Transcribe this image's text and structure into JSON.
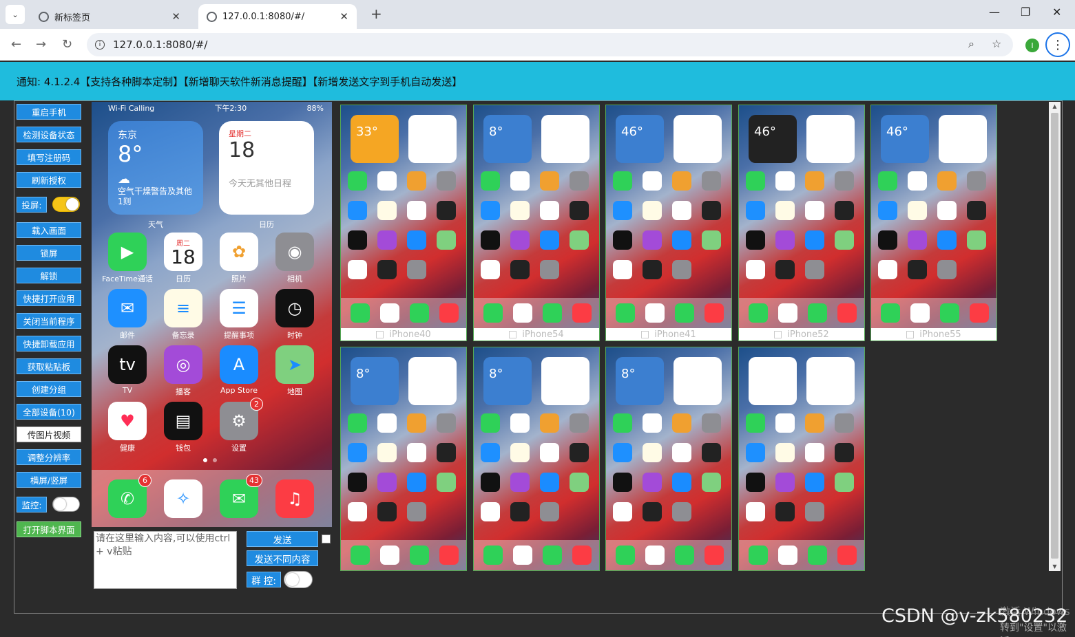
{
  "browser": {
    "tabs": [
      {
        "label": "新标签页"
      },
      {
        "label": "127.0.0.1:8080/#/"
      }
    ],
    "url": "127.0.0.1:8080/#/",
    "profile_initial": "I"
  },
  "notice": {
    "text": "通知:   4.1.2.4【支持各种脚本定制】【新增聊天软件新消息提醒】【新增发送文字到手机自动发送】"
  },
  "sidebar": {
    "items": [
      {
        "label": "重启手机"
      },
      {
        "label": "检测设备状态"
      },
      {
        "label": "填写注册码"
      },
      {
        "label": "刷新授权"
      },
      {
        "label": "投屏:"
      },
      {
        "label": "载入画面"
      },
      {
        "label": "锁屏"
      },
      {
        "label": "解锁"
      },
      {
        "label": "快捷打开应用"
      },
      {
        "label": "关闭当前程序"
      },
      {
        "label": "快捷卸载应用"
      },
      {
        "label": "获取粘贴板"
      },
      {
        "label": "创建分组"
      },
      {
        "label": "全部设备(10)"
      },
      {
        "label": "传图片视频"
      },
      {
        "label": "调整分辨率"
      },
      {
        "label": "横屏/竖屏"
      },
      {
        "label": "监控:"
      },
      {
        "label": "打开脚本界面"
      }
    ],
    "screen_cast_on": true,
    "monitor_on": false
  },
  "main_phone": {
    "status_left": "Wi-Fi Calling",
    "status_time": "下午2:30",
    "status_battery": "88%",
    "weather": {
      "city": "东京",
      "temp": "8°",
      "desc": "空气干燥警告及其他1则",
      "label": "天气"
    },
    "calendar": {
      "weekday": "星期二",
      "day": "18",
      "desc": "今天无其他日程",
      "label": "日历"
    },
    "apps": [
      {
        "label": "FaceTime通话",
        "icon": "facetime-icon",
        "color": "#2fd158"
      },
      {
        "label": "日历",
        "icon": "calendar-icon",
        "color": "#ffffff",
        "day": "18",
        "weekday": "周二"
      },
      {
        "label": "照片",
        "icon": "photos-icon",
        "color": "#ffffff"
      },
      {
        "label": "相机",
        "icon": "camera-icon",
        "color": "#8e8e93"
      },
      {
        "label": "邮件",
        "icon": "mail-icon",
        "color": "#1e90ff"
      },
      {
        "label": "备忘录",
        "icon": "notes-icon",
        "color": "#fffbe6"
      },
      {
        "label": "提醒事项",
        "icon": "reminders-icon",
        "color": "#ffffff"
      },
      {
        "label": "时钟",
        "icon": "clock-icon",
        "color": "#111111"
      },
      {
        "label": "TV",
        "icon": "appletv-icon",
        "color": "#111111"
      },
      {
        "label": "播客",
        "icon": "podcasts-icon",
        "color": "#a34bd8"
      },
      {
        "label": "App Store",
        "icon": "appstore-icon",
        "color": "#1a8cff"
      },
      {
        "label": "地图",
        "icon": "maps-icon",
        "color": "#7fd07f"
      },
      {
        "label": "健康",
        "icon": "health-icon",
        "color": "#ffffff"
      },
      {
        "label": "钱包",
        "icon": "wallet-icon",
        "color": "#111111"
      },
      {
        "label": "设置",
        "icon": "settings-icon",
        "color": "#8e8e93",
        "badge": "2"
      }
    ],
    "dock": [
      {
        "icon": "phone-icon",
        "color": "#2fd158",
        "badge": "6"
      },
      {
        "icon": "safari-icon",
        "color": "#ffffff"
      },
      {
        "icon": "messages-icon",
        "color": "#2fd158",
        "badge": "43"
      },
      {
        "icon": "music-icon",
        "color": "#fc3c44"
      }
    ]
  },
  "composer": {
    "placeholder": "请在这里输入内容,可以使用ctrl + v粘贴",
    "send_label": "发送",
    "send_diff_label": "发送不同内容",
    "group_label": "群 控:"
  },
  "devices": [
    {
      "name": "iPhone40",
      "widget_color": "#f5a623",
      "temp": "33°"
    },
    {
      "name": "iPhone54",
      "widget_color": "#3c7fd0",
      "temp": "8°"
    },
    {
      "name": "iPhone41",
      "widget_color": "#3c7fd0",
      "temp": "46°"
    },
    {
      "name": "iPhone52",
      "widget_color": "#222222",
      "temp": "46°"
    },
    {
      "name": "iPhone55",
      "widget_color": "#3c7fd0",
      "temp": "46°"
    },
    {
      "name": "",
      "widget_color": "#3c7fd0",
      "temp": "8°"
    },
    {
      "name": "",
      "widget_color": "#3c7fd0",
      "temp": "8°"
    },
    {
      "name": "",
      "widget_color": "#3c7fd0",
      "temp": "8°"
    },
    {
      "name": "",
      "widget_color": "#ffffff",
      "temp": ""
    }
  ],
  "watermark": {
    "csdn": "CSDN @v-zk580232",
    "activate": "激活 Windows",
    "goto": "转到\"设置\"以激活"
  }
}
